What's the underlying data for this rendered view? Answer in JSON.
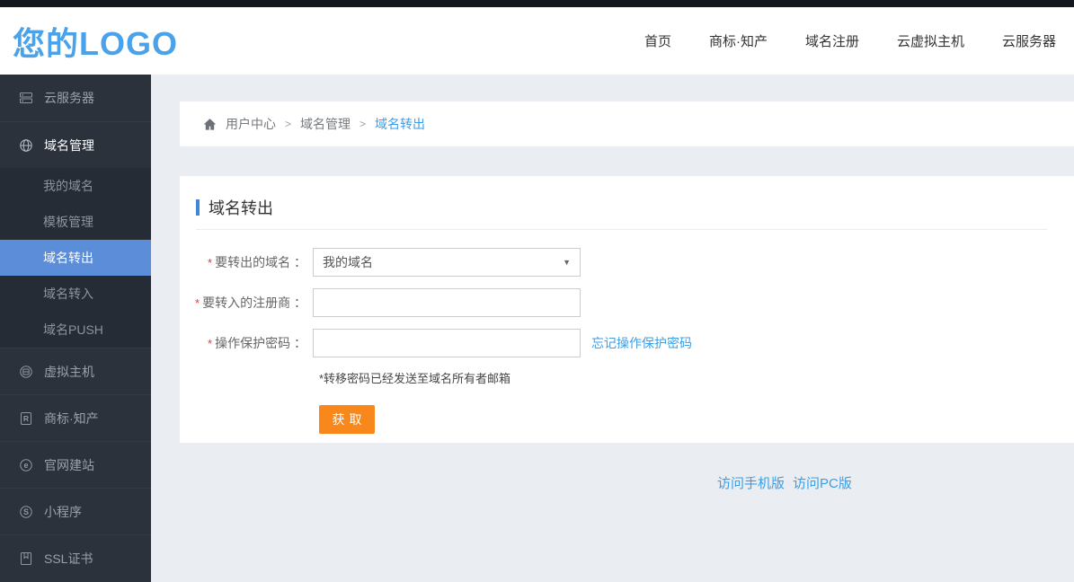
{
  "colors": {
    "accent_blue": "#4aa2ea",
    "active_item_blue": "#5b8dd8",
    "link_blue": "#3b9ee5",
    "button_orange": "#f8881b",
    "sidebar_bg": "#2b323c",
    "page_bg": "#eaedf1"
  },
  "header": {
    "logo": "您的LOGO",
    "nav": [
      "首页",
      "商标·知产",
      "域名注册",
      "云虚拟主机",
      "云服务器"
    ]
  },
  "sidebar": {
    "items": [
      {
        "label": "云服务器",
        "icon": "server-icon"
      },
      {
        "label": "域名管理",
        "icon": "globe-icon"
      },
      {
        "label": "虚拟主机",
        "icon": "host-icon"
      },
      {
        "label": "商标·知产",
        "icon": "trademark-icon"
      },
      {
        "label": "官网建站",
        "icon": "website-icon"
      },
      {
        "label": "小程序",
        "icon": "miniprogram-icon"
      },
      {
        "label": "SSL证书",
        "icon": "certificate-icon"
      }
    ],
    "submenu": [
      "我的域名",
      "模板管理",
      "域名转出",
      "域名转入",
      "域名PUSH"
    ],
    "active_submenu": "域名转出"
  },
  "breadcrumb": {
    "home": "用户中心",
    "sep": ">",
    "level1": "域名管理",
    "current": "域名转出"
  },
  "page": {
    "title": "域名转出"
  },
  "form": {
    "required": "*",
    "rows": [
      {
        "label": "要转出的域名 ：",
        "value": "我的域名"
      },
      {
        "label": "要转入的注册商 ：",
        "value": ""
      },
      {
        "label": "操作保护密码 ：",
        "value": "",
        "link": "忘记操作保护密码"
      }
    ],
    "note": "*转移密码已经发送至域名所有者邮箱",
    "submit": "获取"
  },
  "footer": {
    "links": [
      "访问手机版",
      "访问PC版"
    ]
  }
}
